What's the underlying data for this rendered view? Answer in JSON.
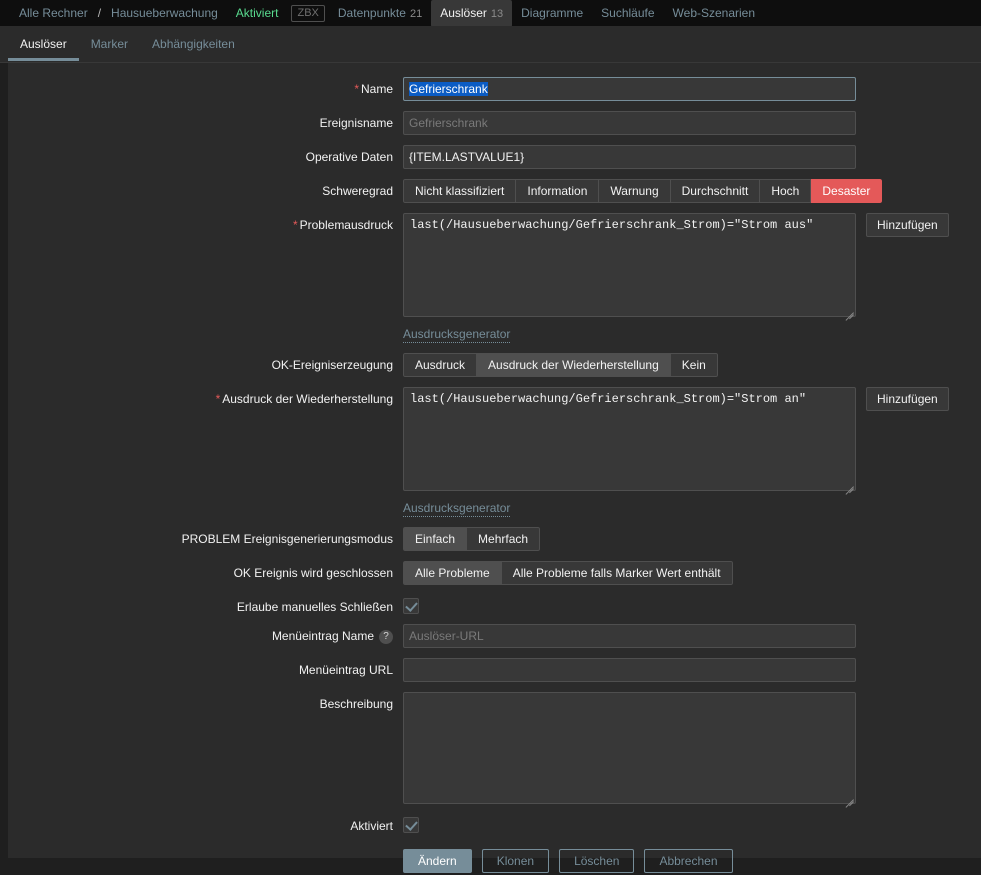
{
  "topnav": {
    "breadcrumb": [
      {
        "label": "Alle Rechner",
        "kind": "link"
      },
      {
        "label": "/",
        "kind": "sep"
      },
      {
        "label": "Hausueberwachung",
        "kind": "link"
      }
    ],
    "status": "Aktiviert",
    "agent_badge": "ZBX",
    "items": [
      {
        "label": "Datenpunkte",
        "count": "21",
        "active": false
      },
      {
        "label": "Auslöser",
        "count": "13",
        "active": true
      },
      {
        "label": "Diagramme",
        "count": "",
        "active": false
      },
      {
        "label": "Suchläufe",
        "count": "",
        "active": false
      },
      {
        "label": "Web-Szenarien",
        "count": "",
        "active": false
      }
    ]
  },
  "subtabs": [
    {
      "label": "Auslöser",
      "active": true
    },
    {
      "label": "Marker",
      "active": false
    },
    {
      "label": "Abhängigkeiten",
      "active": false
    }
  ],
  "form": {
    "name": {
      "label": "Name",
      "value": "Gefrierschrank",
      "required": true
    },
    "event_name": {
      "label": "Ereignisname",
      "placeholder": "Gefrierschrank",
      "value": ""
    },
    "operational_data": {
      "label": "Operative Daten",
      "value": "{ITEM.LASTVALUE1}"
    },
    "severity": {
      "label": "Schweregrad",
      "options": [
        "Nicht klassifiziert",
        "Information",
        "Warnung",
        "Durchschnitt",
        "Hoch",
        "Desaster"
      ],
      "selected": "Desaster",
      "selected_color": "#e45959"
    },
    "problem_expression": {
      "label": "Problemausdruck",
      "required": true,
      "value": "last(/Hausueberwachung/Gefrierschrank_Strom)=\"Strom aus\"",
      "add_button": "Hinzufügen",
      "constructor_link": "Ausdrucksgenerator"
    },
    "ok_event_generation": {
      "label": "OK-Ereigniserzeugung",
      "options": [
        "Ausdruck",
        "Ausdruck der Wiederherstellung",
        "Kein"
      ],
      "selected": "Ausdruck der Wiederherstellung"
    },
    "recovery_expression": {
      "label": "Ausdruck der Wiederherstellung",
      "required": true,
      "value": "last(/Hausueberwachung/Gefrierschrank_Strom)=\"Strom an\"",
      "add_button": "Hinzufügen",
      "constructor_link": "Ausdrucksgenerator"
    },
    "problem_event_generation_mode": {
      "label": "PROBLEM Ereignisgenerierungsmodus",
      "options": [
        "Einfach",
        "Mehrfach"
      ],
      "selected": "Einfach"
    },
    "ok_event_closes": {
      "label": "OK Ereignis wird geschlossen",
      "options": [
        "Alle Probleme",
        "Alle Probleme falls Marker Wert enthält"
      ],
      "selected": "Alle Probleme"
    },
    "allow_manual_close": {
      "label": "Erlaube manuelles Schließen",
      "checked": true
    },
    "menu_entry_name": {
      "label": "Menüeintrag Name",
      "placeholder": "Auslöser-URL",
      "value": "",
      "help": "?"
    },
    "menu_entry_url": {
      "label": "Menüeintrag URL",
      "placeholder": "",
      "value": ""
    },
    "description": {
      "label": "Beschreibung",
      "value": "",
      "placeholder": ""
    },
    "enabled": {
      "label": "Aktiviert",
      "checked": true
    }
  },
  "footer": {
    "update": "Ändern",
    "clone": "Klonen",
    "delete": "Löschen",
    "cancel": "Abbrechen"
  }
}
